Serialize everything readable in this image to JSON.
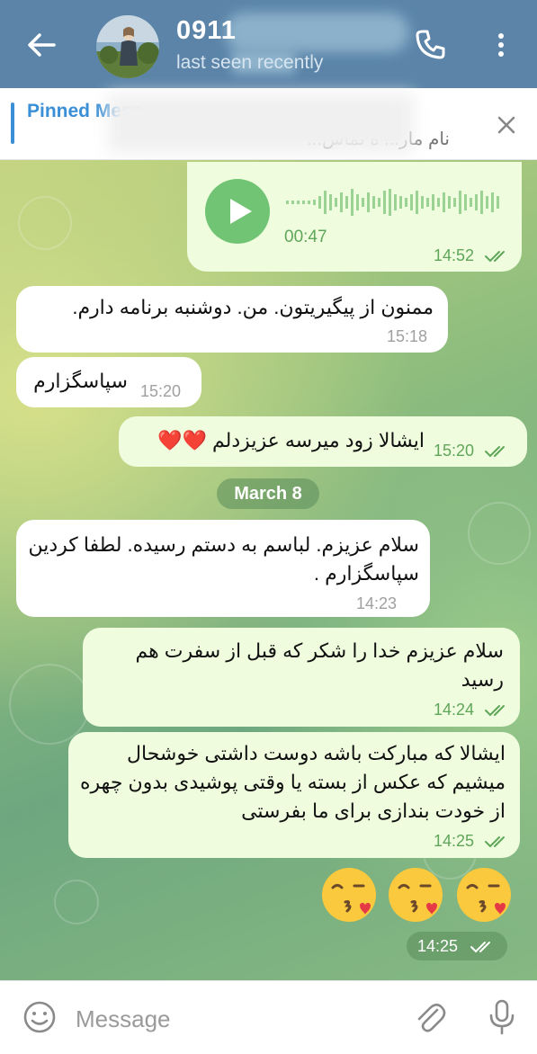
{
  "header": {
    "title": "0911",
    "subtitle": "last seen recently",
    "back_icon": "arrow-left-icon",
    "call_icon": "phone-icon",
    "more_icon": "more-vertical-icon",
    "background": "#5b84a8"
  },
  "pinned": {
    "title": "Pinned Mess",
    "text": "نام مار...  ه تماس...",
    "close_icon": "close-icon"
  },
  "messages": [
    {
      "type": "voice",
      "direction": "out",
      "duration": "00:47",
      "time": "14:52",
      "read": true
    },
    {
      "direction": "in",
      "text": "ممنون از پیگیریتون. من. دوشنبه برنامه دارم.",
      "time": "15:18"
    },
    {
      "direction": "in",
      "text": "سپاسگزارم",
      "time": "15:20"
    },
    {
      "direction": "out",
      "text": "ایشالا زود میرسه عزیزدلم ❤️❤️",
      "time": "15:20",
      "read": true
    },
    {
      "direction": "in",
      "text": "سلام عزیزم. لباسم به دستم رسیده. لطفا کردین سپاسگزارم .",
      "time": "14:23"
    },
    {
      "direction": "out",
      "text": "سلام عزیزم خدا را شکر که قبل از سفرت هم رسید",
      "time": "14:24",
      "read": true
    },
    {
      "direction": "out",
      "text": "ایشالا که مبارکت باشه دوست داشتی خوشحال میشیم که عکس از بسته یا وقتی پوشیدی بدون چهره از خودت بندازی برای ما بفرستی",
      "time": "14:25",
      "read": true
    },
    {
      "type": "emoji",
      "direction": "out",
      "text": "😘😘😘",
      "time": "14:25",
      "read": true
    }
  ],
  "date_separator": "March 8",
  "composer": {
    "placeholder": "Message",
    "emoji_icon": "smile-icon",
    "attach_icon": "paperclip-icon",
    "mic_icon": "microphone-icon"
  },
  "colors": {
    "out_bubble": "#effdde",
    "in_bubble": "#ffffff",
    "accent": "#3a8fd6",
    "tick": "#5fa65a"
  }
}
